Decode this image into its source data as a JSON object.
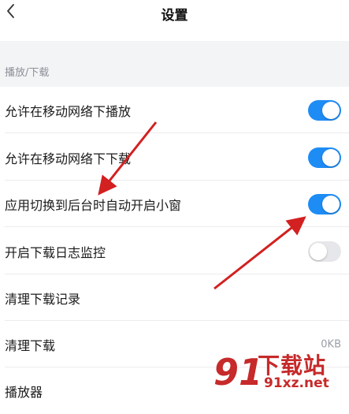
{
  "header": {
    "title": "设置"
  },
  "section": {
    "label": "播放/下载"
  },
  "rows": [
    {
      "label": "允许在移动网络下播放",
      "toggle": true
    },
    {
      "label": "允许在移动网络下下载",
      "toggle": true
    },
    {
      "label": "应用切换到后台时自动开启小窗",
      "toggle": true
    },
    {
      "label": "开启下载日志监控",
      "toggle": false
    },
    {
      "label": "清理下载记录"
    },
    {
      "label": "清理下载",
      "value": "0KB"
    },
    {
      "label": "播放器"
    }
  ],
  "watermark": {
    "brand": "下载站",
    "url": "91xz.net",
    "mark": "91"
  },
  "colors": {
    "toggle_on": "#1e8cf5",
    "toggle_off": "#e6e7ea",
    "arrow": "#d32020",
    "watermark": "#c62a2a"
  }
}
